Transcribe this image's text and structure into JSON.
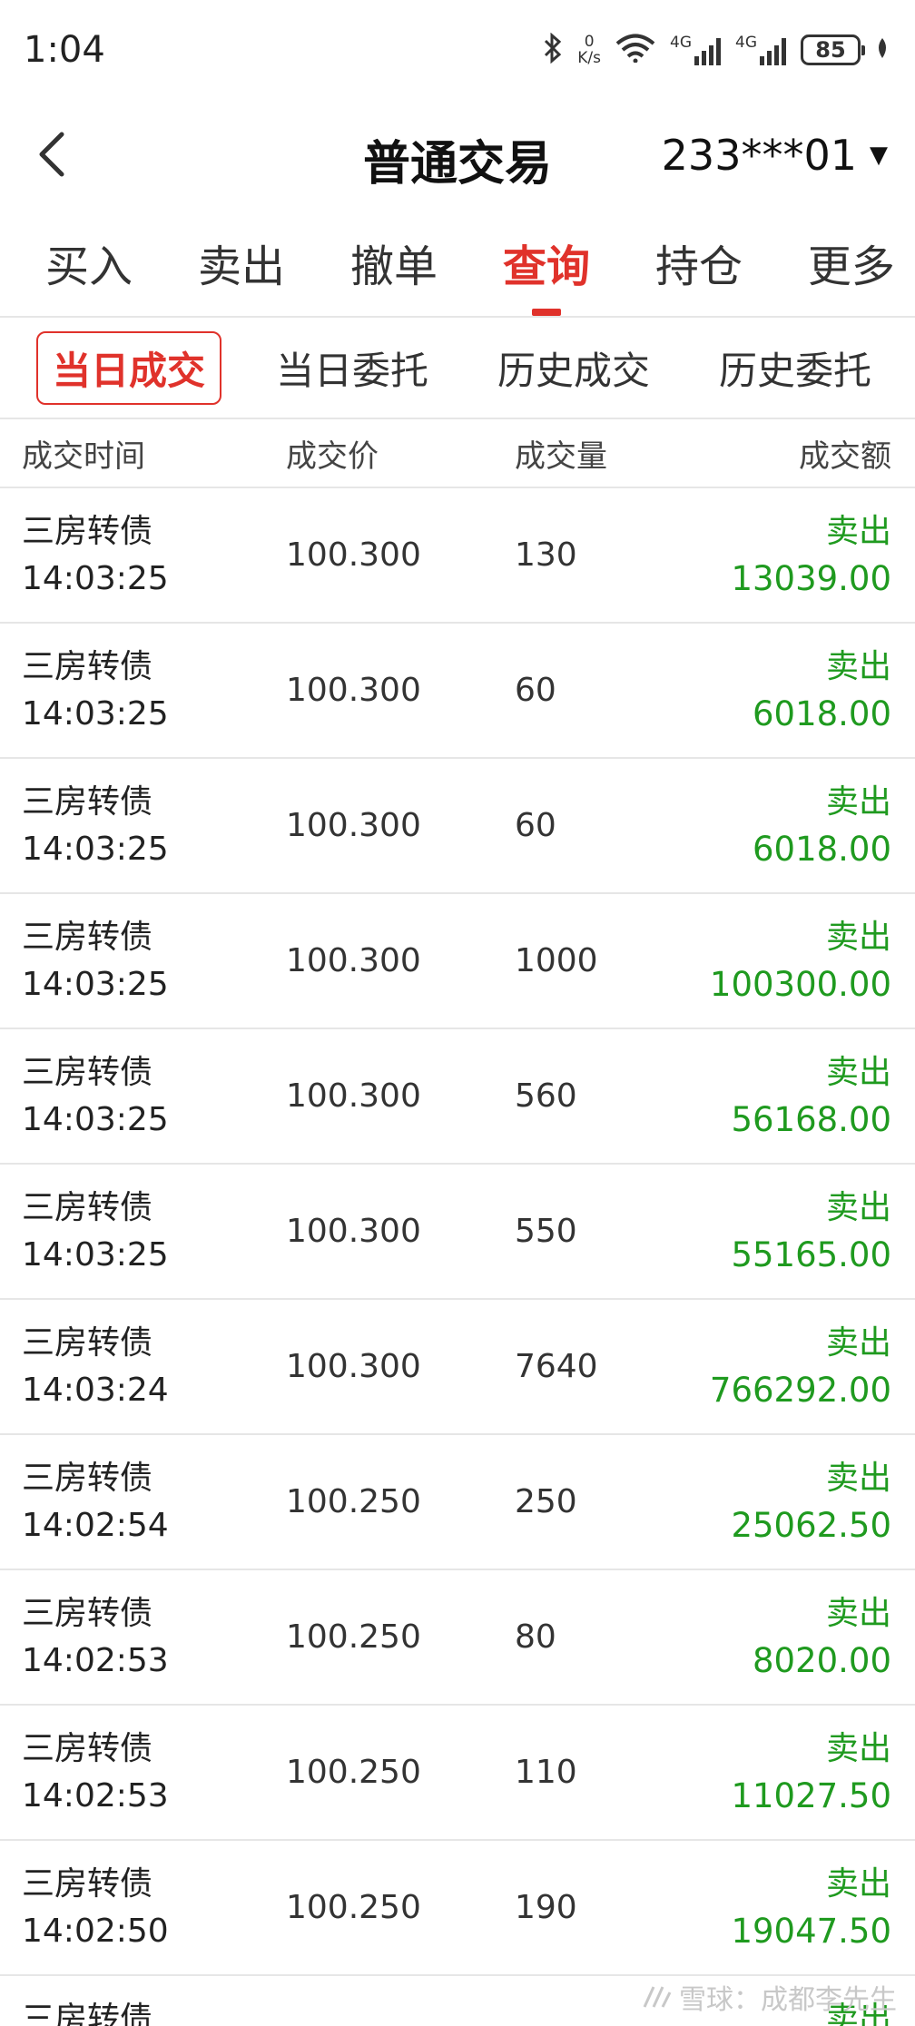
{
  "status_bar": {
    "time": "1:04",
    "net_speed_value": "0",
    "net_speed_unit": "K/s",
    "sim1_label": "4G",
    "sim2_label": "4G",
    "battery": "85"
  },
  "header": {
    "title": "普通交易",
    "account": "233***01"
  },
  "tabs": [
    {
      "label": "买入"
    },
    {
      "label": "卖出"
    },
    {
      "label": "撤单"
    },
    {
      "label": "查询",
      "active": true
    },
    {
      "label": "持仓"
    },
    {
      "label": "更多"
    }
  ],
  "subtabs": [
    {
      "label": "当日成交",
      "active": true
    },
    {
      "label": "当日委托"
    },
    {
      "label": "历史成交"
    },
    {
      "label": "历史委托"
    }
  ],
  "table": {
    "columns": [
      "成交时间",
      "成交价",
      "成交量",
      "成交额"
    ],
    "rows": [
      {
        "name": "三房转债",
        "time": "14:03:25",
        "price": "100.300",
        "qty": "130",
        "side": "卖出",
        "amount": "13039.00"
      },
      {
        "name": "三房转债",
        "time": "14:03:25",
        "price": "100.300",
        "qty": "60",
        "side": "卖出",
        "amount": "6018.00"
      },
      {
        "name": "三房转债",
        "time": "14:03:25",
        "price": "100.300",
        "qty": "60",
        "side": "卖出",
        "amount": "6018.00"
      },
      {
        "name": "三房转债",
        "time": "14:03:25",
        "price": "100.300",
        "qty": "1000",
        "side": "卖出",
        "amount": "100300.00"
      },
      {
        "name": "三房转债",
        "time": "14:03:25",
        "price": "100.300",
        "qty": "560",
        "side": "卖出",
        "amount": "56168.00"
      },
      {
        "name": "三房转债",
        "time": "14:03:25",
        "price": "100.300",
        "qty": "550",
        "side": "卖出",
        "amount": "55165.00"
      },
      {
        "name": "三房转债",
        "time": "14:03:24",
        "price": "100.300",
        "qty": "7640",
        "side": "卖出",
        "amount": "766292.00"
      },
      {
        "name": "三房转债",
        "time": "14:02:54",
        "price": "100.250",
        "qty": "250",
        "side": "卖出",
        "amount": "25062.50"
      },
      {
        "name": "三房转债",
        "time": "14:02:53",
        "price": "100.250",
        "qty": "80",
        "side": "卖出",
        "amount": "8020.00"
      },
      {
        "name": "三房转债",
        "time": "14:02:53",
        "price": "100.250",
        "qty": "110",
        "side": "卖出",
        "amount": "11027.50"
      },
      {
        "name": "三房转债",
        "time": "14:02:50",
        "price": "100.250",
        "qty": "190",
        "side": "卖出",
        "amount": "19047.50"
      },
      {
        "name": "三房转债",
        "time": "",
        "price": "",
        "qty": "",
        "side": "卖出",
        "amount": ""
      }
    ]
  },
  "watermark": "雪球：成都李先生",
  "colors": {
    "accent": "#e0322b",
    "sell": "#1f9a1f"
  }
}
